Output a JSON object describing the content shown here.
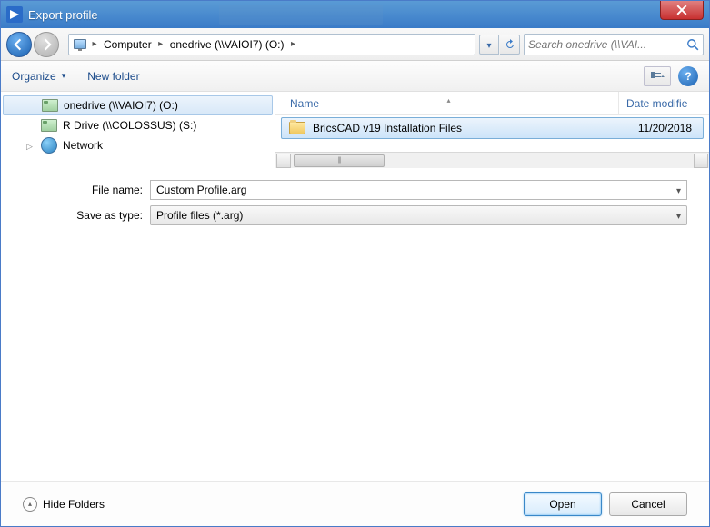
{
  "window": {
    "title": "Export profile"
  },
  "breadcrumb": {
    "root": "Computer",
    "part1": "onedrive (\\\\VAIOI7) (O:)"
  },
  "search": {
    "placeholder": "Search onedrive (\\\\VAI..."
  },
  "toolbar": {
    "organize": "Organize",
    "new_folder": "New folder"
  },
  "tree": {
    "items": [
      {
        "label": "onedrive (\\\\VAIOI7) (O:)"
      },
      {
        "label": "R Drive (\\\\COLOSSUS) (S:)"
      },
      {
        "label": "Network"
      }
    ]
  },
  "columns": {
    "name": "Name",
    "date": "Date modifie"
  },
  "rows": [
    {
      "name": "BricsCAD v19 Installation Files",
      "date": "11/20/2018"
    }
  ],
  "form": {
    "filename_label": "File name:",
    "filename_value": "Custom Profile.arg",
    "type_label": "Save as type:",
    "type_value": "Profile files (*.arg)"
  },
  "footer": {
    "hide": "Hide Folders",
    "open": "Open",
    "cancel": "Cancel"
  }
}
